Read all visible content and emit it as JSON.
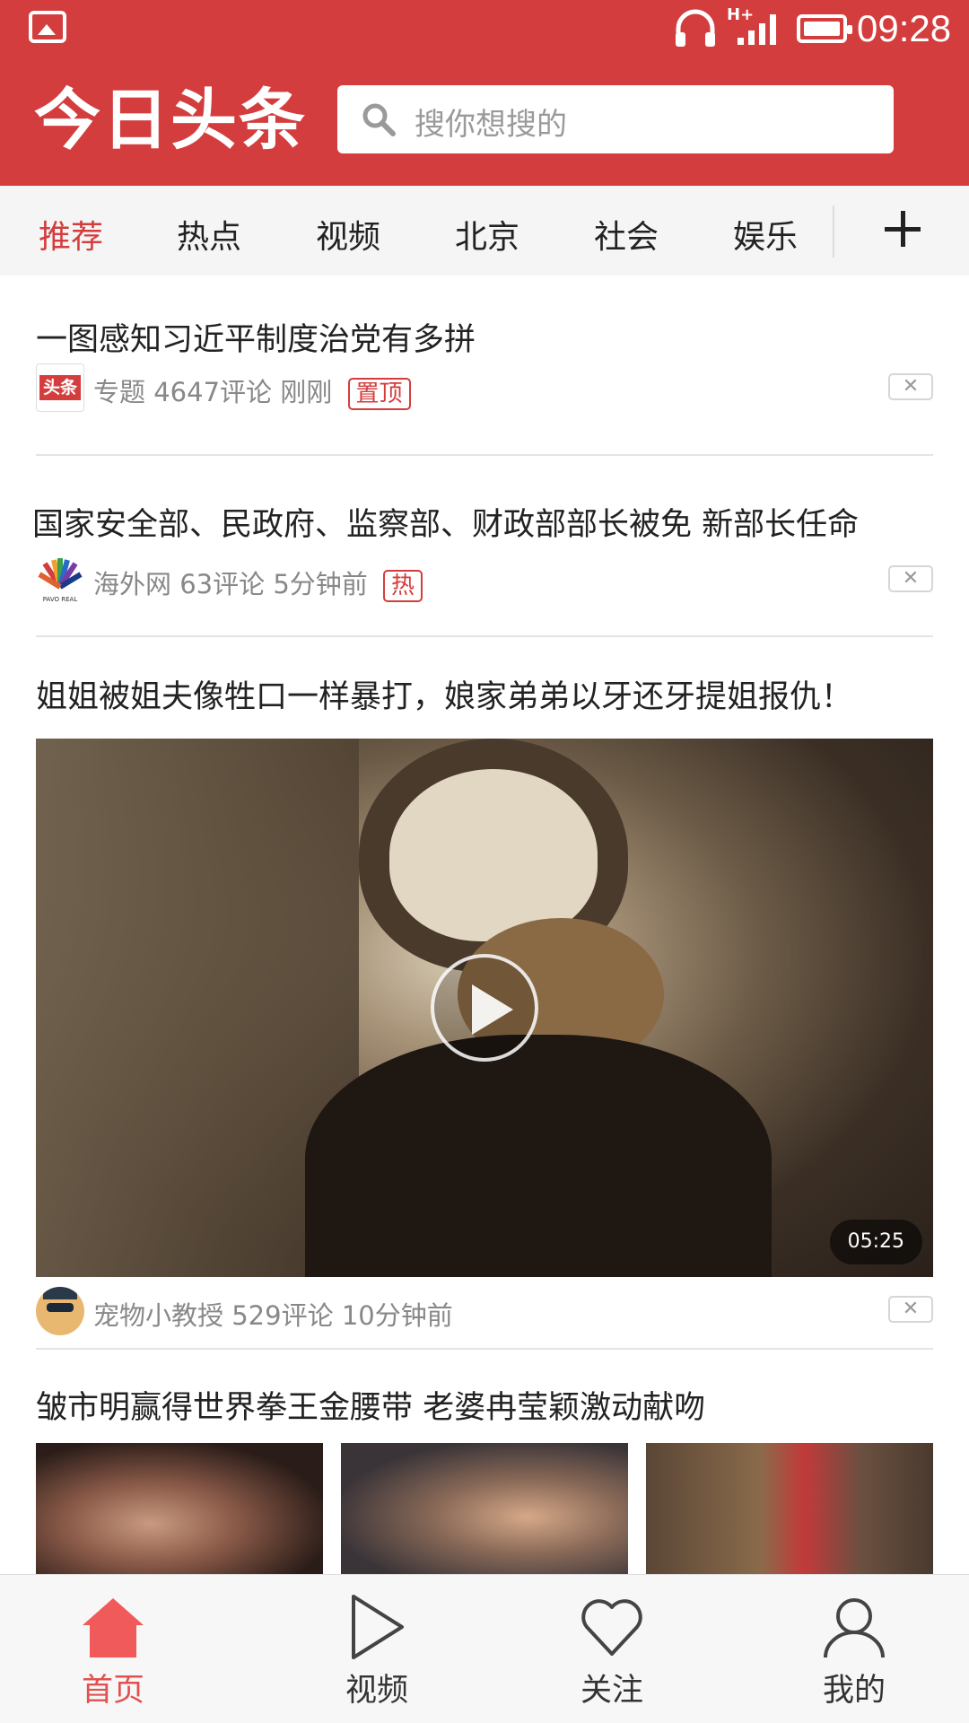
{
  "status_bar": {
    "network": "H+",
    "time": "09:28"
  },
  "header": {
    "logo": "今日头条",
    "search_placeholder": "搜你想搜的"
  },
  "tabs": [
    {
      "label": "推荐",
      "active": true
    },
    {
      "label": "热点"
    },
    {
      "label": "视频"
    },
    {
      "label": "北京"
    },
    {
      "label": "社会"
    },
    {
      "label": "娱乐"
    }
  ],
  "feed": [
    {
      "title": "一图感知习近平制度治党有多拼",
      "source_icon_text": "头条",
      "source": "专题",
      "comments": "4647评论",
      "time": "刚刚",
      "tag": "置顶"
    },
    {
      "title": "国家安全部、民政府、监察部、财政部部长被免 新部长任命",
      "source_icon_text": "PAVO REAL",
      "source": "海外网",
      "comments": "63评论",
      "time": "5分钟前",
      "tag": "热"
    },
    {
      "title": "姐姐被姐夫像牲口一样暴打，娘家弟弟以牙还牙提姐报仇！",
      "duration": "05:25",
      "source": "宠物小教授",
      "comments": "529评论",
      "time": "10分钟前"
    },
    {
      "title": "皱市明赢得世界拳王金腰带 老婆冉莹颖激动献吻"
    }
  ],
  "bottom_nav": [
    {
      "label": "首页",
      "icon": "home-icon",
      "active": true
    },
    {
      "label": "视频",
      "icon": "play-icon"
    },
    {
      "label": "关注",
      "icon": "heart-icon"
    },
    {
      "label": "我的",
      "icon": "user-icon"
    }
  ],
  "colors": {
    "brand_red": "#d43d3d",
    "active_nav": "#e25050"
  }
}
